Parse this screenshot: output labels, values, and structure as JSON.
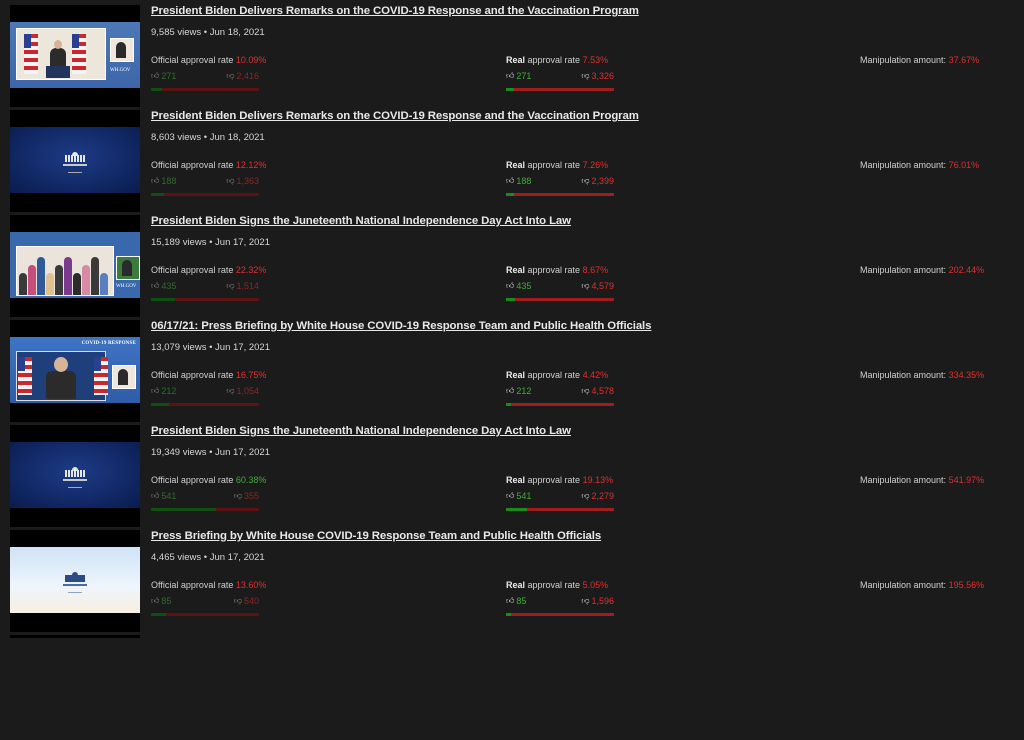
{
  "labels": {
    "official": "Official approval rate",
    "real_prefix": "Real",
    "real_suffix": " approval rate",
    "manip": "Manipulation amount:"
  },
  "colors": {
    "background": "#1b1b1b",
    "positive": "#3fae3a",
    "negative": "#e03030",
    "bar_like": "#1c8a1c",
    "bar_dislike": "#a11d1d"
  },
  "icons": {
    "like": "thumbs-up-icon",
    "dislike": "thumbs-down-icon"
  },
  "videos": [
    {
      "title": "President Biden Delivers Remarks on the COVID-19 Response and the Vaccination Program",
      "meta": "9,585 views • Jun 18, 2021",
      "official_rate": "10.09%",
      "official_likes": "271",
      "official_dislikes": "2,416",
      "official_fill": 0.1,
      "real_rate": "7.53%",
      "real_likes": "271",
      "real_dislikes": "3,326",
      "real_fill": 0.075,
      "manip": "37.67%",
      "thumb_type": "biden"
    },
    {
      "title": "President Biden Delivers Remarks on the COVID-19 Response and the Vaccination Program",
      "meta": "8,603 views • Jun 18, 2021",
      "official_rate": "12.12%",
      "official_likes": "188",
      "official_dislikes": "1,363",
      "official_fill": 0.12,
      "real_rate": "7.26%",
      "real_likes": "188",
      "real_dislikes": "2,399",
      "real_fill": 0.073,
      "manip": "76.01%",
      "thumb_type": "navy"
    },
    {
      "title": "President Biden Signs the Juneteenth National Independence Day Act Into Law",
      "meta": "15,189 views • Jun 17, 2021",
      "official_rate": "22.32%",
      "official_likes": "435",
      "official_dislikes": "1,514",
      "official_fill": 0.22,
      "real_rate": "8.67%",
      "real_likes": "435",
      "real_dislikes": "4,579",
      "real_fill": 0.087,
      "manip": "202.44%",
      "thumb_type": "juneteenth"
    },
    {
      "title": "06/17/21: Press Briefing by White House COVID-19 Response Team and Public Health Officials",
      "meta": "13,079 views • Jun 17, 2021",
      "official_rate": "16.75%",
      "official_likes": "212",
      "official_dislikes": "1,054",
      "official_fill": 0.17,
      "real_rate": "4.42%",
      "real_likes": "212",
      "real_dislikes": "4,578",
      "real_fill": 0.044,
      "manip": "334.35%",
      "thumb_type": "fauci",
      "banner": "COVID-19 RESPONSE"
    },
    {
      "title": "President Biden Signs the Juneteenth National Independence Day Act Into Law",
      "meta": "19,349 views • Jun 17, 2021",
      "official_rate": "60.38%",
      "official_likes": "541",
      "official_dislikes": "355",
      "official_fill": 0.6,
      "official_green": true,
      "real_rate": "19.13%",
      "real_likes": "541",
      "real_dislikes": "2,279",
      "real_fill": 0.19,
      "manip": "541.97%",
      "thumb_type": "navy"
    },
    {
      "title": "Press Briefing by White House COVID-19 Response Team and Public Health Officials",
      "meta": "4,465 views • Jun 17, 2021",
      "official_rate": "13.60%",
      "official_likes": "85",
      "official_dislikes": "540",
      "official_fill": 0.14,
      "real_rate": "5.05%",
      "real_likes": "85",
      "real_dislikes": "1,596",
      "real_fill": 0.05,
      "manip": "195.56%",
      "thumb_type": "sky"
    }
  ]
}
